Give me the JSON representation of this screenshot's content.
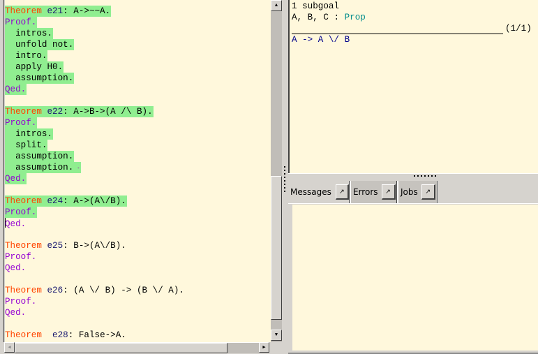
{
  "script": {
    "lines": [
      {
        "parts": [
          {
            "c": "kw-th",
            "t": "Theorem"
          },
          {
            "c": "tx",
            "t": " "
          },
          {
            "c": "kw-name",
            "t": "e21"
          },
          {
            "c": "tx",
            "t": ": A->~~A."
          }
        ],
        "processed": true
      },
      {
        "parts": [
          {
            "c": "kw-proof",
            "t": "Proof."
          }
        ],
        "processed": true
      },
      {
        "parts": [
          {
            "c": "tx",
            "t": "  intros."
          }
        ],
        "processed": true
      },
      {
        "parts": [
          {
            "c": "tx",
            "t": "  unfold not."
          }
        ],
        "processed": true
      },
      {
        "parts": [
          {
            "c": "tx",
            "t": "  intro."
          }
        ],
        "processed": true
      },
      {
        "parts": [
          {
            "c": "tx",
            "t": "  apply H0."
          }
        ],
        "processed": true
      },
      {
        "parts": [
          {
            "c": "tx",
            "t": "  assumption."
          }
        ],
        "processed": true
      },
      {
        "parts": [
          {
            "c": "kw-proof",
            "t": "Qed."
          }
        ],
        "processed": true
      },
      {
        "parts": [],
        "processed": false
      },
      {
        "parts": [
          {
            "c": "kw-th",
            "t": "Theorem"
          },
          {
            "c": "tx",
            "t": " "
          },
          {
            "c": "kw-name",
            "t": "e22"
          },
          {
            "c": "tx",
            "t": ": A->B->(A /\\ B)."
          }
        ],
        "processed": true
      },
      {
        "parts": [
          {
            "c": "kw-proof",
            "t": "Proof."
          }
        ],
        "processed": true
      },
      {
        "parts": [
          {
            "c": "tx",
            "t": "  intros."
          }
        ],
        "processed": true
      },
      {
        "parts": [
          {
            "c": "tx",
            "t": "  split."
          }
        ],
        "processed": true
      },
      {
        "parts": [
          {
            "c": "tx",
            "t": "  assumption."
          }
        ],
        "processed": true
      },
      {
        "parts": [
          {
            "c": "tx",
            "t": "  assumption."
          },
          {
            "c": "dot-mark",
            "t": " •"
          }
        ],
        "processed": true
      },
      {
        "parts": [
          {
            "c": "kw-proof",
            "t": "Qed."
          }
        ],
        "processed": true
      },
      {
        "parts": [],
        "processed": false
      },
      {
        "parts": [
          {
            "c": "kw-th",
            "t": "Theorem"
          },
          {
            "c": "tx",
            "t": " "
          },
          {
            "c": "kw-name",
            "t": "e24"
          },
          {
            "c": "tx",
            "t": ": A->(A\\/B)."
          }
        ],
        "processed": true
      },
      {
        "parts": [
          {
            "c": "kw-proof",
            "t": "Proof."
          }
        ],
        "processed": true
      },
      {
        "parts": [
          {
            "c": "caret",
            "t": ""
          },
          {
            "c": "kw-proof",
            "t": "Qed."
          }
        ],
        "processed": false
      },
      {
        "parts": [],
        "processed": false
      },
      {
        "parts": [
          {
            "c": "kw-th",
            "t": "Theorem"
          },
          {
            "c": "tx",
            "t": " "
          },
          {
            "c": "kw-name",
            "t": "e25"
          },
          {
            "c": "tx",
            "t": ": B->(A\\/B)."
          }
        ],
        "processed": false
      },
      {
        "parts": [
          {
            "c": "kw-proof",
            "t": "Proof."
          }
        ],
        "processed": false
      },
      {
        "parts": [
          {
            "c": "kw-proof",
            "t": "Qed."
          }
        ],
        "processed": false
      },
      {
        "parts": [],
        "processed": false
      },
      {
        "parts": [
          {
            "c": "kw-th",
            "t": "Theorem"
          },
          {
            "c": "tx",
            "t": " "
          },
          {
            "c": "kw-name",
            "t": "e26"
          },
          {
            "c": "tx",
            "t": ": (A \\/ B) -> (B \\/ A)."
          }
        ],
        "processed": false
      },
      {
        "parts": [
          {
            "c": "kw-proof",
            "t": "Proof."
          }
        ],
        "processed": false
      },
      {
        "parts": [
          {
            "c": "kw-proof",
            "t": "Qed."
          }
        ],
        "processed": false
      },
      {
        "parts": [],
        "processed": false
      },
      {
        "parts": [
          {
            "c": "kw-th",
            "t": "Theorem"
          },
          {
            "c": "tx",
            "t": "  "
          },
          {
            "c": "kw-name",
            "t": "e28"
          },
          {
            "c": "tx",
            "t": ": False->A."
          }
        ],
        "processed": false
      }
    ]
  },
  "goals": {
    "count_text": "1 subgoal",
    "hyp_names": "A, B, C : ",
    "hyp_type": "Prop",
    "goal_index": "(1/1)",
    "conclusion": "A -> A \\/ B"
  },
  "tabs": [
    {
      "label": "Messages",
      "detach_icon": "↗",
      "active": true
    },
    {
      "label": "Errors",
      "detach_icon": "↗",
      "active": false
    },
    {
      "label": "Jobs",
      "detach_icon": "↗",
      "active": false
    }
  ],
  "scrollbar_glyphs": {
    "up": "▲",
    "down": "▼",
    "left": "◀",
    "right": "▶"
  },
  "colors": {
    "editor_bg": "#fff8dc",
    "processed_bg": "#90ee90",
    "keyword": "#ff4500",
    "proof_kw": "#9400d3"
  }
}
